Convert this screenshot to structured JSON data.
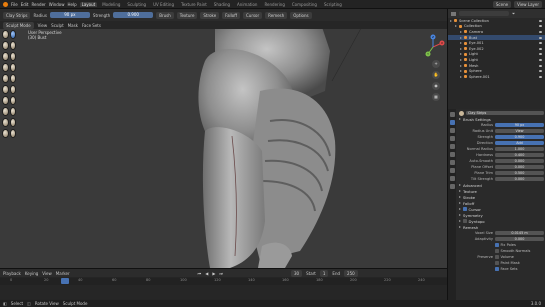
{
  "topbar": {
    "menus": [
      "File",
      "Edit",
      "Render",
      "Window",
      "Help"
    ],
    "workspaces": [
      "Layout",
      "Modeling",
      "Sculpting",
      "UV Editing",
      "Texture Paint",
      "Shading",
      "Animation",
      "Rendering",
      "Compositing",
      "Scripting"
    ],
    "active_workspace": "Layout",
    "scene_label": "Scene",
    "view_layer_label": "View Layer"
  },
  "tool_header": {
    "brush_name": "Clay Strips",
    "radius_label": "Radius",
    "radius_value": "90 px",
    "strength_label": "Strength",
    "strength_value": "0.900",
    "brush_menu": "Brush",
    "texture_menu": "Texture",
    "stroke_menu": "Stroke",
    "falloff_menu": "Falloff",
    "cursor_menu": "Cursor",
    "remesh_label": "Remesh",
    "options_label": "Options"
  },
  "view_header": {
    "mode": "Sculpt Mode",
    "view": "View",
    "sculpt": "Sculpt",
    "mask": "Mask",
    "face_sets": "Face Sets"
  },
  "viewport": {
    "view_name": "User Perspective",
    "object_name": "(30) Bust"
  },
  "gizmo": {
    "x": "X",
    "y": "Y",
    "z": "Z"
  },
  "timeline": {
    "menus": [
      "Playback",
      "Keying",
      "View",
      "Marker"
    ],
    "current_frame": "30",
    "start_label": "Start",
    "start": "1",
    "end_label": "End",
    "end": "250",
    "ticks": [
      "0",
      "20",
      "40",
      "60",
      "80",
      "100",
      "120",
      "140",
      "160",
      "180",
      "200",
      "220",
      "240"
    ]
  },
  "outliner": {
    "items": [
      {
        "name": "Scene Collection",
        "depth": 0
      },
      {
        "name": "Collection",
        "depth": 1
      },
      {
        "name": "Camera",
        "depth": 2
      },
      {
        "name": "Bust",
        "depth": 2,
        "selected": true
      },
      {
        "name": "Eye.001",
        "depth": 2
      },
      {
        "name": "Eye.002",
        "depth": 2
      },
      {
        "name": "Light",
        "depth": 2
      },
      {
        "name": "Light",
        "depth": 2
      },
      {
        "name": "Mesh",
        "depth": 2
      },
      {
        "name": "Sphere",
        "depth": 2
      },
      {
        "name": "Sphere.001",
        "depth": 2
      }
    ]
  },
  "properties": {
    "brush_name": "Clay Strips",
    "sections": {
      "brush_settings": "Brush Settings",
      "advanced": "Advanced",
      "texture": "Texture",
      "stroke": "Stroke",
      "falloff": "Falloff",
      "cursor": "Cursor",
      "symmetry": "Symmetry",
      "dyntopo": "Dyntopo",
      "remesh": "Remesh"
    },
    "fields": [
      {
        "label": "Radius",
        "value": "90 px"
      },
      {
        "label": "Radius Unit",
        "value": "View"
      },
      {
        "label": "Strength",
        "value": "0.900"
      },
      {
        "label": "Direction",
        "value": "Add"
      },
      {
        "label": "Normal Radius",
        "value": "1.000"
      },
      {
        "label": "Hardness",
        "value": "0.400"
      },
      {
        "label": "Auto-Smooth",
        "value": "0.000"
      },
      {
        "label": "Plane Offset",
        "value": "0.000"
      },
      {
        "label": "Plane Trim",
        "value": "0.500"
      },
      {
        "label": "Tilt Strength",
        "value": "0.000"
      }
    ],
    "remesh_fields": [
      {
        "label": "Voxel Size",
        "value": "0.0145 m"
      },
      {
        "label": "Adaptivity",
        "value": "0.000"
      }
    ],
    "remesh_toggles": [
      "Fix Poles",
      "Smooth Normals"
    ],
    "preserve_label": "Preserve",
    "preserve_items": [
      "Volume",
      "Paint Mask",
      "Face Sets"
    ]
  },
  "status": {
    "left": "Select",
    "middle": "Rotate View",
    "right": "Sculpt Mode",
    "version": "3.0.0"
  }
}
